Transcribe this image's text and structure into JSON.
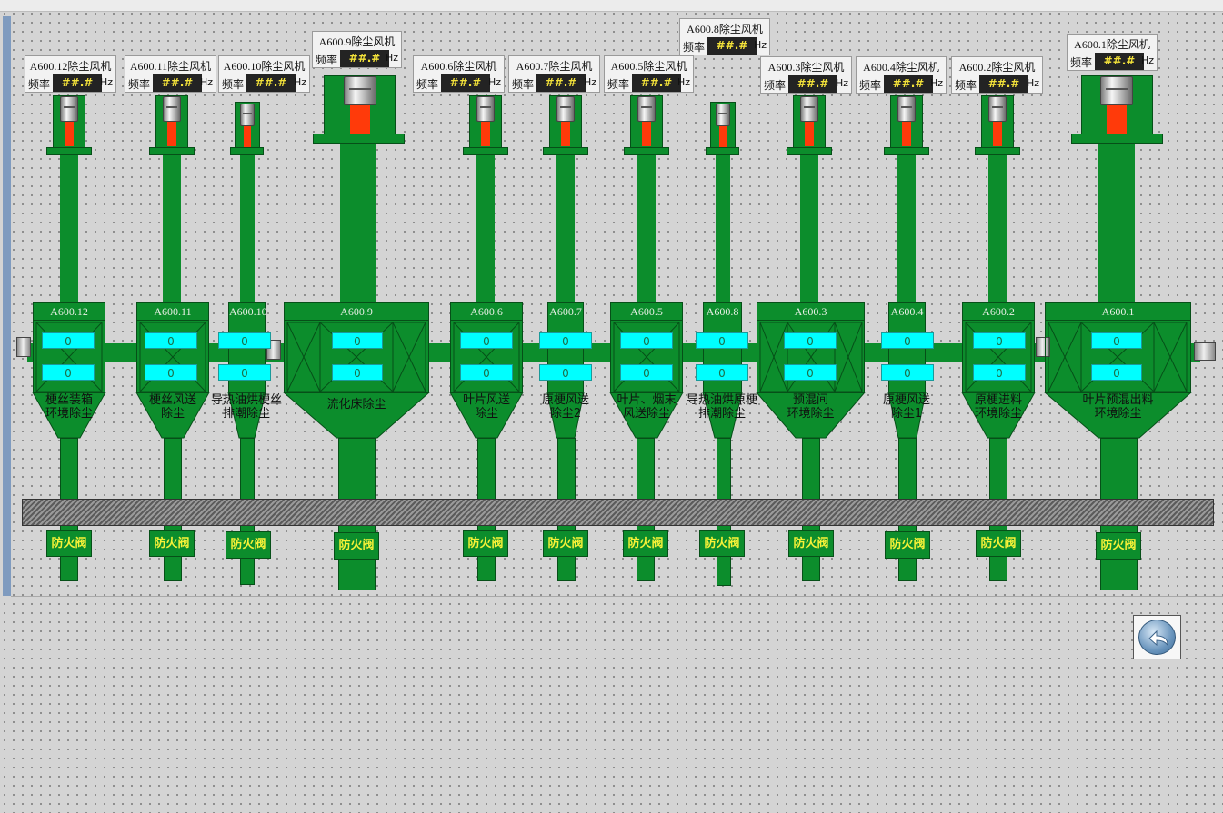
{
  "colors": {
    "duct": "#0c8d2c",
    "shaft": "#ff3a0a",
    "counter": "#00ffff",
    "valve_text": "#f7f238",
    "readout_text": "#f3e23a"
  },
  "icons": {
    "motor": "motor-icon",
    "back": "back-arrow-icon",
    "end_fan": "side-fan-icon"
  },
  "fans": [
    {
      "title": "A600.12除尘风机",
      "freq_label": "频率",
      "freq": "##.#",
      "unit": "Hz"
    },
    {
      "title": "A600.11除尘风机",
      "freq_label": "频率",
      "freq": "##.#",
      "unit": "Hz"
    },
    {
      "title": "A600.10除尘风机",
      "freq_label": "频率",
      "freq": "##.#",
      "unit": "Hz"
    },
    {
      "title": "A600.9除尘风机",
      "freq_label": "频率",
      "freq": "##.#",
      "unit": "Hz"
    },
    {
      "title": "A600.6除尘风机",
      "freq_label": "频率",
      "freq": "##.#",
      "unit": "Hz"
    },
    {
      "title": "A600.7除尘风机",
      "freq_label": "频率",
      "freq": "##.#",
      "unit": "Hz"
    },
    {
      "title": "A600.5除尘风机",
      "freq_label": "频率",
      "freq": "##.#",
      "unit": "Hz"
    },
    {
      "title": "A600.8除尘风机",
      "freq_label": "频率",
      "freq": "##.#",
      "unit": "Hz"
    },
    {
      "title": "A600.3除尘风机",
      "freq_label": "频率",
      "freq": "##.#",
      "unit": "Hz"
    },
    {
      "title": "A600.4除尘风机",
      "freq_label": "频率",
      "freq": "##.#",
      "unit": "Hz"
    },
    {
      "title": "A600.2除尘风机",
      "freq_label": "频率",
      "freq": "##.#",
      "unit": "Hz"
    },
    {
      "title": "A600.1除尘风机",
      "freq_label": "频率",
      "freq": "##.#",
      "unit": "Hz"
    }
  ],
  "units": [
    {
      "code": "A600.12",
      "top": "0",
      "bottom": "0",
      "name1": "梗丝装箱",
      "name2": "环境除尘",
      "valve": "防火阀"
    },
    {
      "code": "A600.11",
      "top": "0",
      "bottom": "0",
      "name1": "梗丝风送",
      "name2": "除尘",
      "valve": "防火阀"
    },
    {
      "code": "A600.10",
      "top": "0",
      "bottom": "0",
      "name1": "导热油烘梗丝",
      "name2": "排潮除尘",
      "valve": "防火阀"
    },
    {
      "code": "A600.9",
      "top": "0",
      "bottom": "0",
      "name1": "流化床除尘",
      "name2": "",
      "valve": "防火阀"
    },
    {
      "code": "A600.6",
      "top": "0",
      "bottom": "0",
      "name1": "叶片风送",
      "name2": "除尘",
      "valve": "防火阀"
    },
    {
      "code": "A600.7",
      "top": "0",
      "bottom": "0",
      "name1": "原梗风送",
      "name2": "除尘2",
      "valve": "防火阀"
    },
    {
      "code": "A600.5",
      "top": "0",
      "bottom": "0",
      "name1": "叶片、烟末",
      "name2": "风送除尘",
      "valve": "防火阀"
    },
    {
      "code": "A600.8",
      "top": "0",
      "bottom": "0",
      "name1": "导热油烘原梗",
      "name2": "排潮除尘",
      "valve": "防火阀"
    },
    {
      "code": "A600.3",
      "top": "0",
      "bottom": "0",
      "name1": "预混间",
      "name2": "环境除尘",
      "valve": "防火阀"
    },
    {
      "code": "A600.4",
      "top": "0",
      "bottom": "0",
      "name1": "原梗风送",
      "name2": "除尘1",
      "valve": "防火阀"
    },
    {
      "code": "A600.2",
      "top": "0",
      "bottom": "0",
      "name1": "原梗进料",
      "name2": "环境除尘",
      "valve": "防火阀"
    },
    {
      "code": "A600.1",
      "top": "0",
      "bottom": "0",
      "name1": "叶片预混出料",
      "name2": "环境除尘",
      "valve": "防火阀"
    }
  ]
}
